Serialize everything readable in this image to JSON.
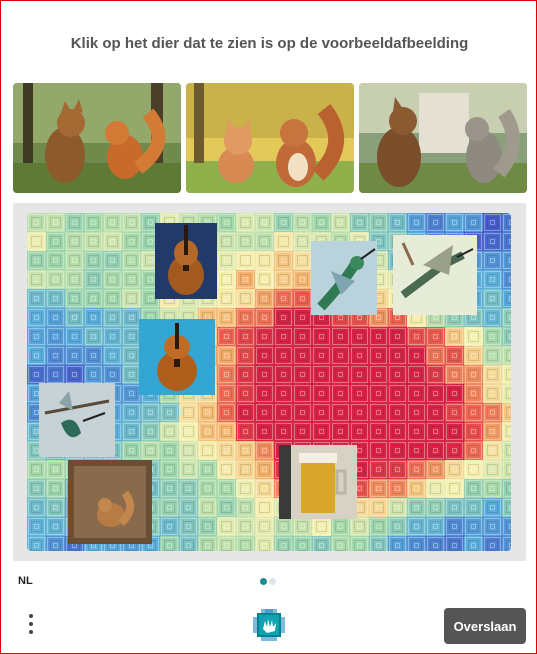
{
  "prompt": {
    "text": "Klik op het dier dat te zien is op de voorbeeldafbeelding"
  },
  "examples": [
    {
      "icon": "cat-and-squirrel-forest-image"
    },
    {
      "icon": "cartoon-cat-and-squirrel-park-image"
    },
    {
      "icon": "cat-and-squirrel-mosaic-image"
    }
  ],
  "grid": {
    "images": [
      {
        "icon": "violin-image"
      },
      {
        "icon": "hummingbird-image"
      },
      {
        "icon": "hummingbird-flying-image"
      },
      {
        "icon": "violin-closeup-image"
      },
      {
        "icon": "hummingbird-branch-image"
      },
      {
        "icon": "squirrel-on-wood-image"
      },
      {
        "icon": "beer-glass-image"
      }
    ]
  },
  "footer": {
    "language": "NL",
    "skip_label": "Overslaan",
    "menu_icon": "more-vertical-icon",
    "logo_icon": "hcaptcha-logo-icon"
  },
  "colors": {
    "border": "#e00000",
    "skip_button": "#555555",
    "page_dot_active": "#1a8c8c",
    "page_dot_inactive": "#d9e7ea"
  }
}
